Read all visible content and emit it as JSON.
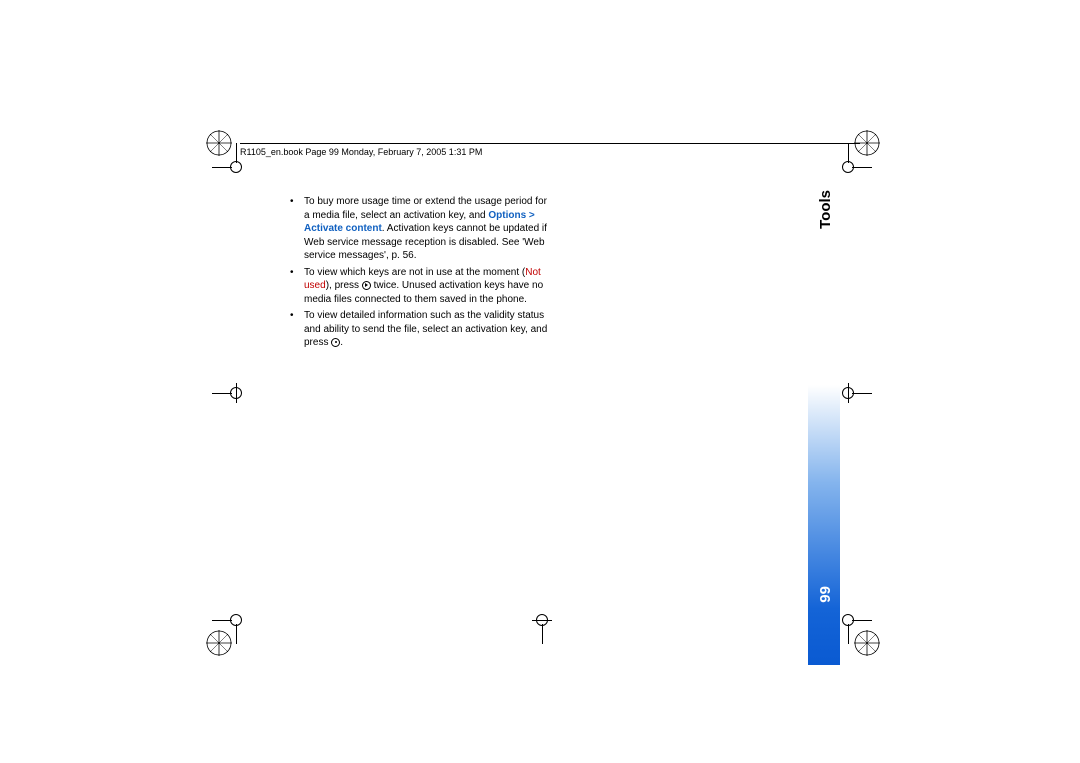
{
  "header": {
    "text": "R1105_en.book  Page 99  Monday, February 7, 2005  1:31 PM"
  },
  "sidebar": {
    "section_title": "Tools",
    "page_number": "99"
  },
  "bullets": [
    {
      "pre": "To buy more usage time or extend the usage period for a media file, select an activation key, and ",
      "blue": "Options > Activate content",
      "post": ". Activation keys cannot be updated if Web service message reception is disabled. See 'Web service messages', p. 56."
    },
    {
      "pre": "To view which keys are not in use at the moment (",
      "red": "Not used",
      "mid": "), press ",
      "post": " twice. Unused activation keys have no media files connected to them saved in the phone."
    },
    {
      "pre": "To view detailed information such as the validity status and ability to send the file, select an activation key, and press ",
      "post": "."
    }
  ]
}
